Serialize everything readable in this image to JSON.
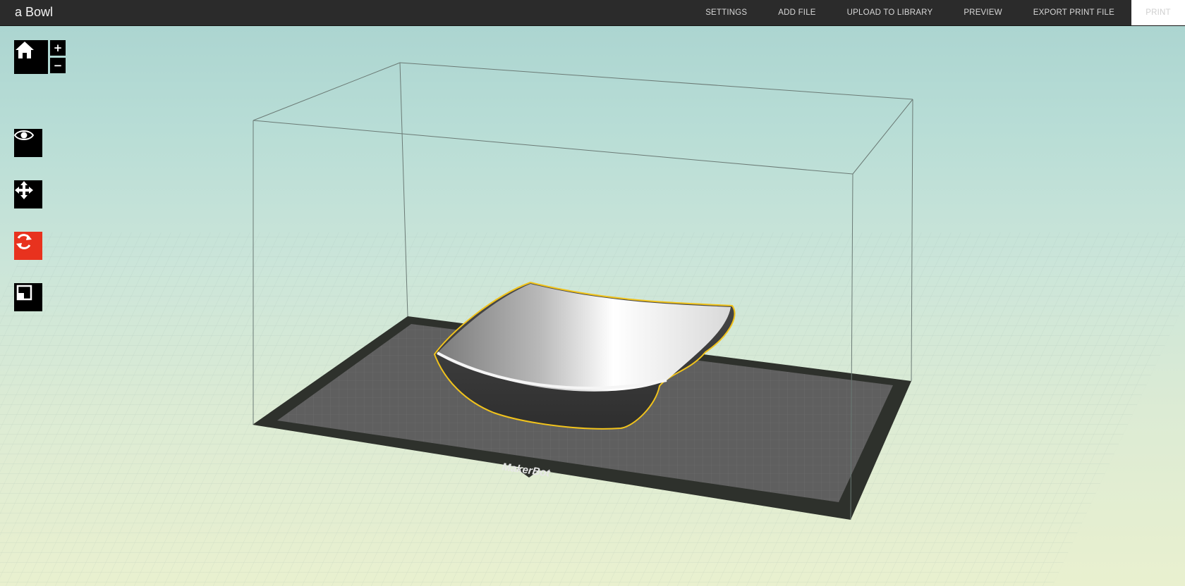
{
  "app": {
    "title": "a Bowl"
  },
  "menu": {
    "items": [
      {
        "id": "settings",
        "label": "SETTINGS"
      },
      {
        "id": "add-file",
        "label": "ADD FILE"
      },
      {
        "id": "upload",
        "label": "UPLOAD TO LIBRARY"
      },
      {
        "id": "preview",
        "label": "PREVIEW"
      },
      {
        "id": "export",
        "label": "EXPORT PRINT FILE"
      }
    ],
    "print_label": "PRINT"
  },
  "toolbar": {
    "home_icon": "home-icon",
    "zoom_in": "+",
    "zoom_out": "−",
    "tools": [
      {
        "id": "view",
        "icon": "eye-icon"
      },
      {
        "id": "move",
        "icon": "move-arrows-icon"
      },
      {
        "id": "rotate",
        "icon": "rotate-icon",
        "active": true
      },
      {
        "id": "scale",
        "icon": "scale-icon"
      }
    ]
  },
  "scene": {
    "platform_brand": "MakerBot",
    "model_name": "Bowl",
    "selection_color": "#f1c31c",
    "active_tool_color": "#e8321e"
  }
}
